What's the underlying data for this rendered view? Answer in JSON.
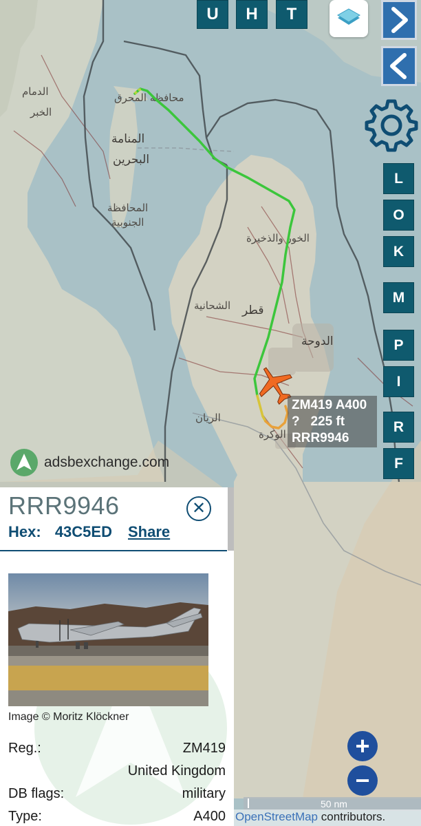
{
  "toolbar": {
    "u": "U",
    "h": "H",
    "t": "T"
  },
  "side_buttons": [
    "L",
    "O",
    "K",
    "M",
    "P",
    "I",
    "R",
    "F"
  ],
  "map_labels": {
    "dammam": "الدمام",
    "khobar": "الخبر",
    "muharraq": "محافظة المحرق",
    "manama": "المنامة",
    "bahrain": "البحرين",
    "southern_gov": "المحافظة",
    "southern_gov2": "الجنوبية",
    "khor": "الخور والذخيرة",
    "shamal": "الشحانية",
    "qatar": "قطر",
    "doha": "الدوحة",
    "rayyan": "الريان",
    "wakra": "الوكرة"
  },
  "aircraft_label": {
    "line1": "ZM419 A400",
    "line2": "?   225 ft",
    "line3": "RRR9946"
  },
  "branding": {
    "site": "adsbexchange.com"
  },
  "panel": {
    "callsign": "RRR9946",
    "hex_label": "Hex:",
    "hex_value": "43C5ED",
    "share": "Share",
    "close_symbol": "✕",
    "image_credit": "Image © Moritz Klöckner",
    "rows": [
      {
        "label": "Reg.:",
        "value": "ZM419"
      },
      {
        "label": "",
        "value": "United Kingdom"
      },
      {
        "label": "DB flags:",
        "value": "military"
      },
      {
        "label": "Type:",
        "value": "A400"
      }
    ]
  },
  "zoom": {
    "in": "+",
    "out": "−"
  },
  "scale": {
    "label": "50 nm"
  },
  "attribution": {
    "osm": "OpenStreetMap",
    "rest": " contributors."
  },
  "colors": {
    "button_teal": "#0f5a6e",
    "nav_blue": "#2f6fae",
    "track_green": "#3cc63c",
    "track_yellow": "#d7c43a",
    "track_orange": "#e8a13a",
    "aircraft_orange": "#f06a22",
    "zoom_blue": "#1f4f9d",
    "panel_text_blue": "#0f4d73"
  }
}
